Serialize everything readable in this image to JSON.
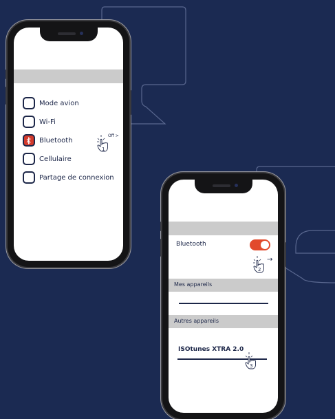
{
  "phone1": {
    "items": [
      {
        "label": "Mode avion",
        "checked": false
      },
      {
        "label": "Wi-Fi",
        "checked": false
      },
      {
        "label": "Bluetooth",
        "checked": true,
        "icon": "bluetooth-icon"
      },
      {
        "label": "Cellulaire",
        "checked": false
      },
      {
        "label": "Partage de connexion",
        "checked": false
      }
    ],
    "tap_step": "1",
    "tap_hint": "Off >"
  },
  "phone2": {
    "bluetooth_label": "Bluetooth",
    "bluetooth_on": true,
    "tap_step_toggle": "2",
    "arrow": "→",
    "section_my_devices": "Mes appareils",
    "section_other_devices": "Autres appareils",
    "device_name": "ISOtunes XTRA 2.0",
    "tap_step_device": "3"
  },
  "colors": {
    "background": "#1b2a52",
    "accent": "#e24a2c",
    "text": "#1c2648"
  }
}
